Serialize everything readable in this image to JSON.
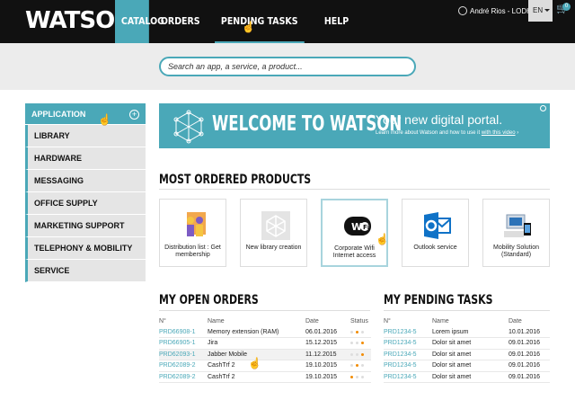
{
  "brand": "WATSON",
  "nav": [
    "CATALOG",
    "ORDERS",
    "PENDING TASKS",
    "HELP"
  ],
  "user": "André Rios - LODH",
  "language": "EN",
  "cart_count": "0",
  "search_placeholder": "Search an app, a service, a product...",
  "sidebar": [
    "APPLICATION",
    "LIBRARY",
    "HARDWARE",
    "MESSAGING",
    "OFFICE SUPPLY",
    "MARKETING SUPPORT",
    "TELEPHONY & MOBILITY",
    "SERVICE"
  ],
  "welcome": {
    "title": "WELCOME TO WATSON",
    "subtitle": "Your new digital portal.",
    "body": "Learn more about Watson and how to use it",
    "link": "with this video"
  },
  "products_title": "MOST ORDERED PRODUCTS",
  "products": [
    {
      "name": "Distribution list : Get membership",
      "icon": "people-icon"
    },
    {
      "name": "New library creation",
      "icon": "cube-icon"
    },
    {
      "name": "Corporate Wifi Internet access",
      "icon": "wifi-icon"
    },
    {
      "name": "Outlook service",
      "icon": "outlook-icon"
    },
    {
      "name": "Mobility Solution (Standard)",
      "icon": "mobile-devices-icon"
    }
  ],
  "orders": {
    "title": "MY OPEN ORDERS",
    "headers": [
      "N°",
      "Name",
      "Date",
      "Status"
    ],
    "rows": [
      [
        "PRD66908-1",
        "Memory extension (RAM)",
        "06.01.2016"
      ],
      [
        "PRD66905-1",
        "Jira",
        "15.12.2015"
      ],
      [
        "PRD62093-1",
        "Jabber Mobile",
        "11.12.2015"
      ],
      [
        "PRD62089-2",
        "CashTrf 2",
        "19.10.2015"
      ],
      [
        "PRD62089-2",
        "CashTrf 2",
        "19.10.2015"
      ]
    ]
  },
  "tasks": {
    "title": "MY PENDING TASKS",
    "headers": [
      "N°",
      "Name",
      "Date"
    ],
    "rows": [
      [
        "PRD1234-5",
        "Lorem ipsum",
        "10.01.2016"
      ],
      [
        "PRD1234-5",
        "Dolor sit amet",
        "09.01.2016"
      ],
      [
        "PRD1234-5",
        "Dolor sit amet",
        "09.01.2016"
      ],
      [
        "PRD1234-5",
        "Dolor sit amet",
        "09.01.2016"
      ],
      [
        "PRD1234-5",
        "Dolor sit amet",
        "09.01.2016"
      ]
    ]
  }
}
